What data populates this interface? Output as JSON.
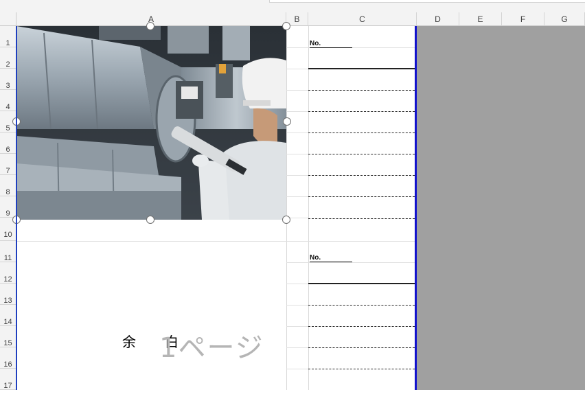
{
  "sheet": {
    "columns": [
      "A",
      "B",
      "C",
      "D",
      "E",
      "F",
      "G"
    ],
    "rows": [
      "1",
      "2",
      "3",
      "4",
      "5",
      "6",
      "7",
      "8",
      "9",
      "10",
      "11",
      "12",
      "13",
      "14",
      "15",
      "16",
      "17"
    ]
  },
  "form": {
    "no_label_1": "No.",
    "no_label_2": "No."
  },
  "blank_text": {
    "char1": "余",
    "char2": "白"
  },
  "page_watermark": "1ページ",
  "image": {
    "subject": "worker-applying-sealant-to-ductwork"
  },
  "colors": {
    "page_border": "#1111cc",
    "outside_print_area": "#a0a0a0",
    "header_bg": "#f3f3f3"
  }
}
